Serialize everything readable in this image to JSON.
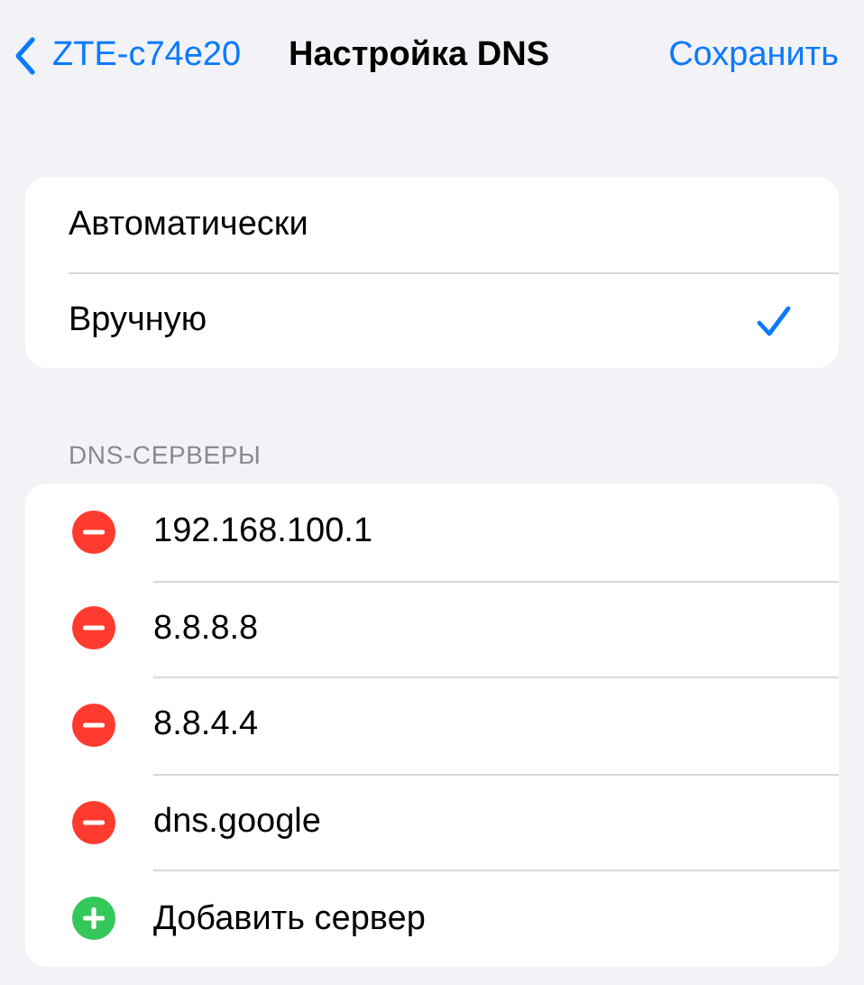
{
  "nav": {
    "back_label": "ZTE-c74e20",
    "title": "Настройка DNS",
    "action": "Сохранить"
  },
  "modes": [
    {
      "label": "Автоматически",
      "selected": false
    },
    {
      "label": "Вручную",
      "selected": true
    }
  ],
  "dns_section": {
    "header": "DNS-СЕРВЕРЫ",
    "items": [
      {
        "kind": "remove",
        "label": "192.168.100.1"
      },
      {
        "kind": "remove",
        "label": "8.8.8.8"
      },
      {
        "kind": "remove",
        "label": "8.8.4.4"
      },
      {
        "kind": "remove",
        "label": "dns.google"
      },
      {
        "kind": "add",
        "label": "Добавить сервер"
      }
    ]
  }
}
